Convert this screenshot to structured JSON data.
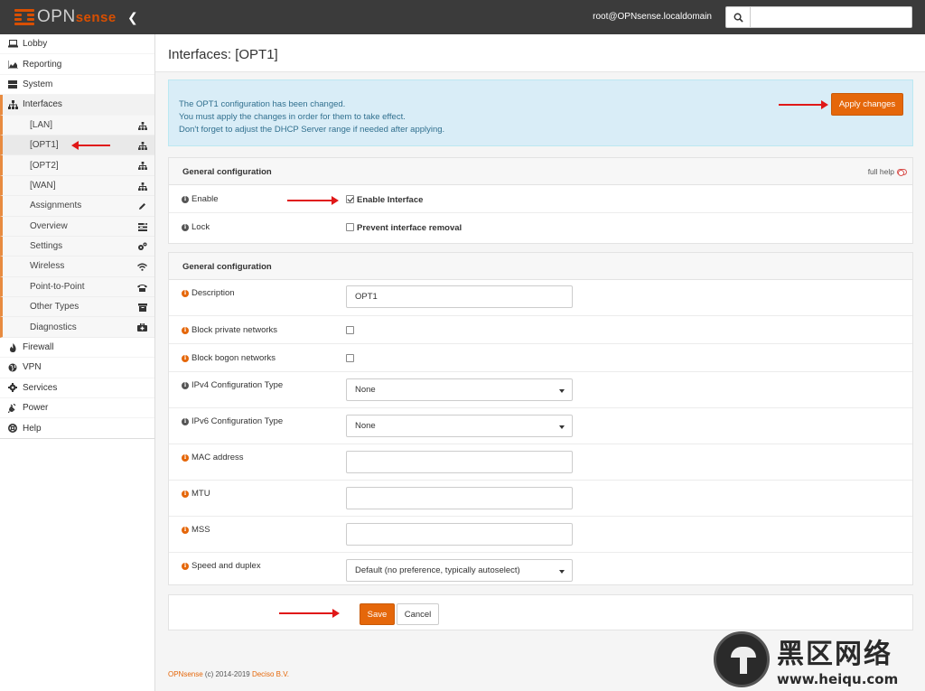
{
  "header": {
    "logo_text_light": "OPN",
    "logo_text_bold": "sense",
    "user": "root@OPNsense.localdomain",
    "search_placeholder": ""
  },
  "sidebar": {
    "items": [
      {
        "label": "Lobby",
        "icon": "laptop-icon"
      },
      {
        "label": "Reporting",
        "icon": "area-chart-icon"
      },
      {
        "label": "System",
        "icon": "server-icon"
      },
      {
        "label": "Interfaces",
        "icon": "sitemap-icon"
      }
    ],
    "interfaces_sub": [
      {
        "label": "[LAN]",
        "icon": "sitemap-icon"
      },
      {
        "label": "[OPT1]",
        "icon": "sitemap-icon"
      },
      {
        "label": "[OPT2]",
        "icon": "sitemap-icon"
      },
      {
        "label": "[WAN]",
        "icon": "sitemap-icon"
      },
      {
        "label": "Assignments",
        "icon": "pencil-icon"
      },
      {
        "label": "Overview",
        "icon": "tasks-icon"
      },
      {
        "label": "Settings",
        "icon": "cogs-icon"
      },
      {
        "label": "Wireless",
        "icon": "wifi-icon"
      },
      {
        "label": "Point-to-Point",
        "icon": "phone-icon"
      },
      {
        "label": "Other Types",
        "icon": "archive-icon"
      },
      {
        "label": "Diagnostics",
        "icon": "medkit-icon"
      }
    ],
    "bottom_items": [
      {
        "label": "Firewall",
        "icon": "fire-icon"
      },
      {
        "label": "VPN",
        "icon": "globe-icon"
      },
      {
        "label": "Services",
        "icon": "cog-icon"
      },
      {
        "label": "Power",
        "icon": "plug-icon"
      },
      {
        "label": "Help",
        "icon": "life-ring-icon"
      }
    ]
  },
  "page": {
    "title": "Interfaces: [OPT1]"
  },
  "alert": {
    "line1": "The OPT1 configuration has been changed.",
    "line2": "You must apply the changes in order for them to take effect.",
    "line3": "Don't forget to adjust the DHCP Server range if needed after applying.",
    "apply_label": "Apply changes"
  },
  "panel1": {
    "title": "General configuration",
    "full_help": "full help",
    "enable_label": "Enable",
    "enable_checkbox_label": "Enable Interface",
    "enable_checked": true,
    "lock_label": "Lock",
    "lock_checkbox_label": "Prevent interface removal",
    "lock_checked": false
  },
  "panel2": {
    "title": "General configuration",
    "description_label": "Description",
    "description_value": "OPT1",
    "block_private_label": "Block private networks",
    "block_bogon_label": "Block bogon networks",
    "ipv4_label": "IPv4 Configuration Type",
    "ipv4_value": "None",
    "ipv6_label": "IPv6 Configuration Type",
    "ipv6_value": "None",
    "mac_label": "MAC address",
    "mac_value": "",
    "mtu_label": "MTU",
    "mtu_value": "",
    "mss_label": "MSS",
    "mss_value": "",
    "speed_label": "Speed and duplex",
    "speed_value": "Default (no preference, typically autoselect)"
  },
  "actions": {
    "save_label": "Save",
    "cancel_label": "Cancel"
  },
  "footer": {
    "brand": "OPNsense",
    "copyright": " (c) 2014-2019 ",
    "company": "Deciso B.V."
  },
  "watermark": {
    "cn": "黑区网络",
    "url": "www.heiqu.com"
  },
  "colors": {
    "accent": "#e5670a",
    "topbar": "#3b3b3b",
    "alert_bg": "#d9edf7",
    "arrow": "#e01818"
  }
}
